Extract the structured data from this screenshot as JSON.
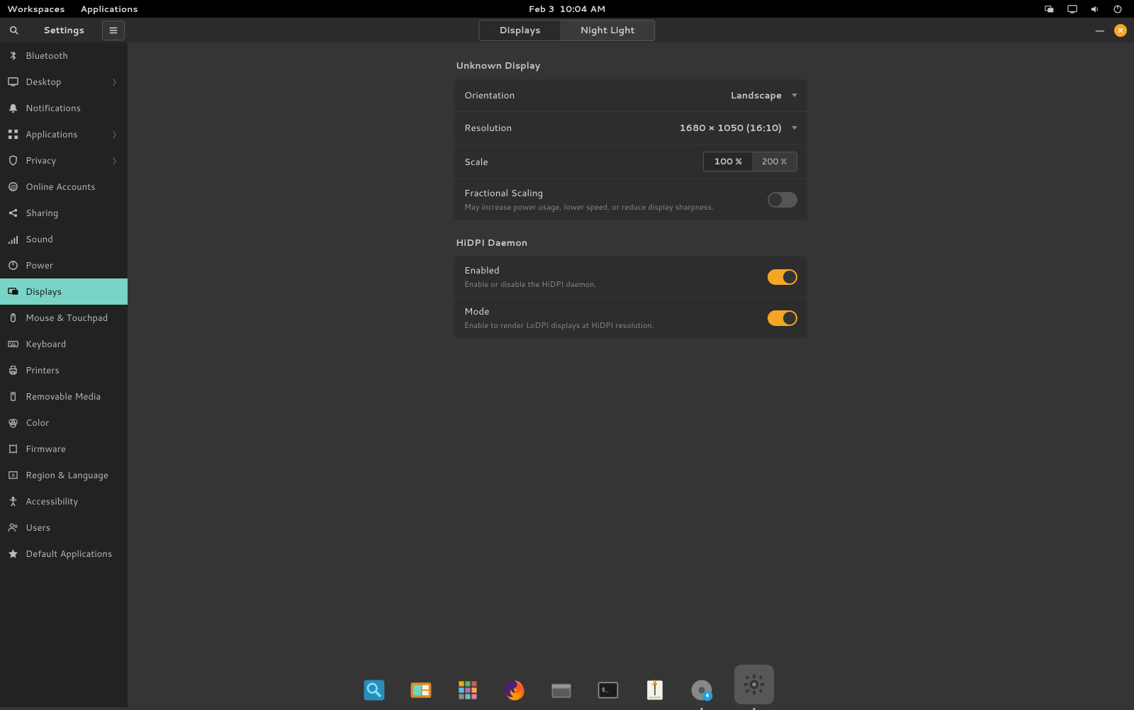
{
  "topbar": {
    "workspaces": "Workspaces",
    "applications": "Applications",
    "date": "Feb 3",
    "time": "10:04 AM"
  },
  "window": {
    "title": "Settings",
    "tabs": [
      {
        "label": "Displays",
        "active": true
      },
      {
        "label": "Night Light",
        "active": false
      }
    ]
  },
  "sidebar": {
    "items": [
      {
        "icon": "bluetooth",
        "label": "Bluetooth",
        "chevron": false
      },
      {
        "icon": "desktop",
        "label": "Desktop",
        "chevron": true
      },
      {
        "icon": "notifications",
        "label": "Notifications",
        "chevron": false
      },
      {
        "icon": "applications",
        "label": "Applications",
        "chevron": true
      },
      {
        "icon": "privacy",
        "label": "Privacy",
        "chevron": true
      },
      {
        "icon": "online-accounts",
        "label": "Online Accounts",
        "chevron": false
      },
      {
        "icon": "sharing",
        "label": "Sharing",
        "chevron": false
      },
      {
        "icon": "sound",
        "label": "Sound",
        "chevron": false
      },
      {
        "icon": "power",
        "label": "Power",
        "chevron": false
      },
      {
        "icon": "displays",
        "label": "Displays",
        "chevron": false,
        "active": true
      },
      {
        "icon": "mouse",
        "label": "Mouse & Touchpad",
        "chevron": false
      },
      {
        "icon": "keyboard",
        "label": "Keyboard",
        "chevron": false
      },
      {
        "icon": "printers",
        "label": "Printers",
        "chevron": false
      },
      {
        "icon": "removable",
        "label": "Removable Media",
        "chevron": false
      },
      {
        "icon": "color",
        "label": "Color",
        "chevron": false
      },
      {
        "icon": "firmware",
        "label": "Firmware",
        "chevron": false
      },
      {
        "icon": "region",
        "label": "Region & Language",
        "chevron": false
      },
      {
        "icon": "accessibility",
        "label": "Accessibility",
        "chevron": false
      },
      {
        "icon": "users",
        "label": "Users",
        "chevron": false
      },
      {
        "icon": "default-apps",
        "label": "Default Applications",
        "chevron": false
      }
    ]
  },
  "main": {
    "section1": {
      "title": "Unknown Display",
      "orientation": {
        "label": "Orientation",
        "value": "Landscape"
      },
      "resolution": {
        "label": "Resolution",
        "value": "1680 × 1050 (16:10)"
      },
      "scale": {
        "label": "Scale",
        "options": [
          "100 %",
          "200 %"
        ],
        "selected": 0
      },
      "fractional": {
        "label": "Fractional Scaling",
        "sub": "May increase power usage, lower speed, or reduce display sharpness.",
        "on": false
      }
    },
    "section2": {
      "title": "HiDPI Daemon",
      "enabled": {
        "label": "Enabled",
        "sub": "Enable or disable the HiDPI daemon.",
        "on": true
      },
      "mode": {
        "label": "Mode",
        "sub": "Enable to render LoDPI displays at HiDPI resolution.",
        "on": true
      }
    }
  },
  "dock": {
    "items": [
      {
        "name": "search-app"
      },
      {
        "name": "workspace-app"
      },
      {
        "name": "apps-grid"
      },
      {
        "name": "firefox"
      },
      {
        "name": "files"
      },
      {
        "name": "terminal"
      },
      {
        "name": "writer"
      },
      {
        "name": "installer",
        "running": true
      },
      {
        "name": "settings",
        "running": true,
        "highlight": true
      }
    ]
  }
}
